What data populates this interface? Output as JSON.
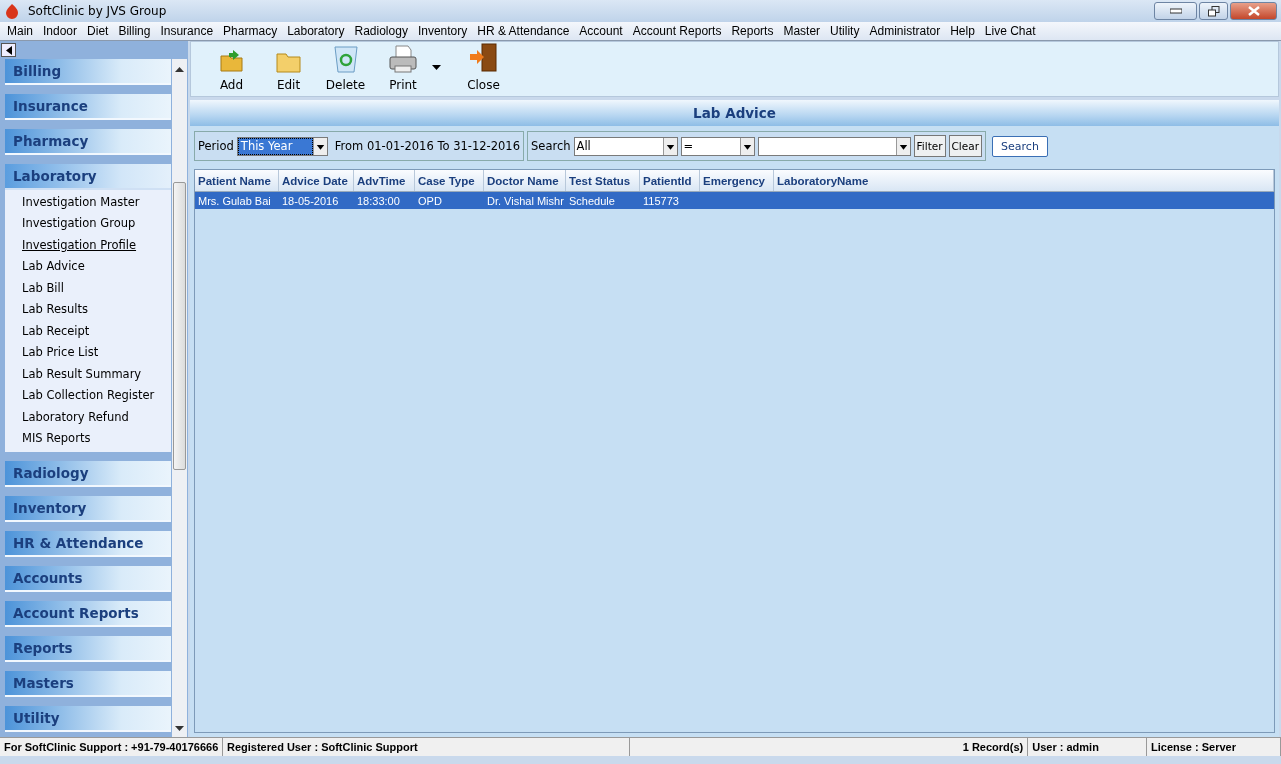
{
  "window": {
    "title": "SoftClinic by JVS Group"
  },
  "menu": [
    "Main",
    "Indoor",
    "Diet",
    "Billing",
    "Insurance",
    "Pharmacy",
    "Laboratory",
    "Radiology",
    "Inventory",
    "HR & Attendance",
    "Account",
    "Account Reports",
    "Reports",
    "Master",
    "Utility",
    "Administrator",
    "Help",
    "Live Chat"
  ],
  "sidebar": {
    "groups": [
      {
        "label": "Billing",
        "expanded": false
      },
      {
        "label": "Insurance",
        "expanded": false
      },
      {
        "label": "Pharmacy",
        "expanded": false
      },
      {
        "label": "Laboratory",
        "expanded": true,
        "items": [
          {
            "label": "Investigation Master",
            "hovered": false
          },
          {
            "label": "Investigation Group",
            "hovered": false
          },
          {
            "label": "Investigation Profile",
            "hovered": true
          },
          {
            "label": "Lab Advice",
            "hovered": false
          },
          {
            "label": "Lab Bill",
            "hovered": false
          },
          {
            "label": "Lab Results",
            "hovered": false
          },
          {
            "label": "Lab Receipt",
            "hovered": false
          },
          {
            "label": "Lab Price List",
            "hovered": false
          },
          {
            "label": "Lab Result Summary",
            "hovered": false
          },
          {
            "label": "Lab Collection Register",
            "hovered": false
          },
          {
            "label": "Laboratory Refund",
            "hovered": false
          },
          {
            "label": "MIS Reports",
            "hovered": false
          }
        ]
      },
      {
        "label": "Radiology",
        "expanded": false
      },
      {
        "label": "Inventory",
        "expanded": false
      },
      {
        "label": "HR & Attendance",
        "expanded": false
      },
      {
        "label": "Accounts",
        "expanded": false
      },
      {
        "label": "Account Reports",
        "expanded": false
      },
      {
        "label": "Reports",
        "expanded": false
      },
      {
        "label": "Masters",
        "expanded": false
      },
      {
        "label": "Utility",
        "expanded": false
      }
    ]
  },
  "toolbar": [
    {
      "label": "Add",
      "kind": "add"
    },
    {
      "label": "Edit",
      "kind": "edit"
    },
    {
      "label": "Delete",
      "kind": "delete"
    },
    {
      "label": "Print",
      "kind": "print"
    },
    {
      "label": "Close",
      "kind": "close"
    }
  ],
  "panel_title": "Lab Advice",
  "filter": {
    "period_label": "Period",
    "period_value": "This Year",
    "range": "From  01-01-2016 To 31-12-2016",
    "search_label": "Search",
    "search_field": "All",
    "operator": "=",
    "buttons": [
      "Filter",
      "Clear"
    ],
    "search_button": "Search"
  },
  "table": {
    "columns": [
      {
        "label": "Patient Name"
      },
      {
        "label": "Advice Date"
      },
      {
        "label": "AdvTime"
      },
      {
        "label": "Case Type"
      },
      {
        "label": "Doctor Name"
      },
      {
        "label": "Test Status"
      },
      {
        "label": "PatientId"
      },
      {
        "label": "Emergency"
      },
      {
        "label": "LaboratoryName"
      }
    ],
    "rows": [
      {
        "selected": true,
        "cells": [
          "Mrs. Gulab Bai",
          "18-05-2016",
          "18:33:00",
          "OPD",
          "Dr. Vishal Mishr",
          "Schedule",
          "115773",
          "",
          ""
        ]
      }
    ]
  },
  "status_bar": [
    "For SoftClinic Support : +91-79-40176666",
    "Registered User : SoftClinic Support",
    "1 Record(s)",
    "User : admin",
    "License : Server"
  ]
}
